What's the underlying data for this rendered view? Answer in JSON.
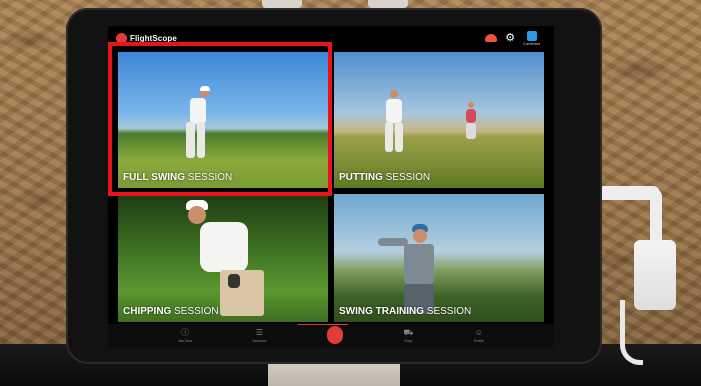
{
  "app": {
    "brand": "FlightScope"
  },
  "topbar": {
    "connected_label": "Connected"
  },
  "tiles": [
    {
      "id": "full-swing",
      "bold": "FULL SWING",
      "rest": " SESSION",
      "selected": true
    },
    {
      "id": "putting",
      "bold": "PUTTING",
      "rest": " SESSION",
      "selected": false
    },
    {
      "id": "chipping",
      "bold": "CHIPPING",
      "rest": " SESSION",
      "selected": false
    },
    {
      "id": "swing-training",
      "bold": "SWING TRAINING",
      "rest": " SESSION",
      "selected": false
    }
  ],
  "bottom_nav": [
    {
      "label": "Ask Now",
      "icon": "info-icon"
    },
    {
      "label": "Sessions",
      "icon": "list-icon"
    },
    {
      "label": "",
      "icon": "flightscope-home-icon"
    },
    {
      "label": "Shop",
      "icon": "cart-icon"
    },
    {
      "label": "Profile",
      "icon": "profile-icon"
    }
  ],
  "colors": {
    "accent": "#e23b3b",
    "highlight": "#e8141b",
    "connected": "#2b9be0"
  }
}
